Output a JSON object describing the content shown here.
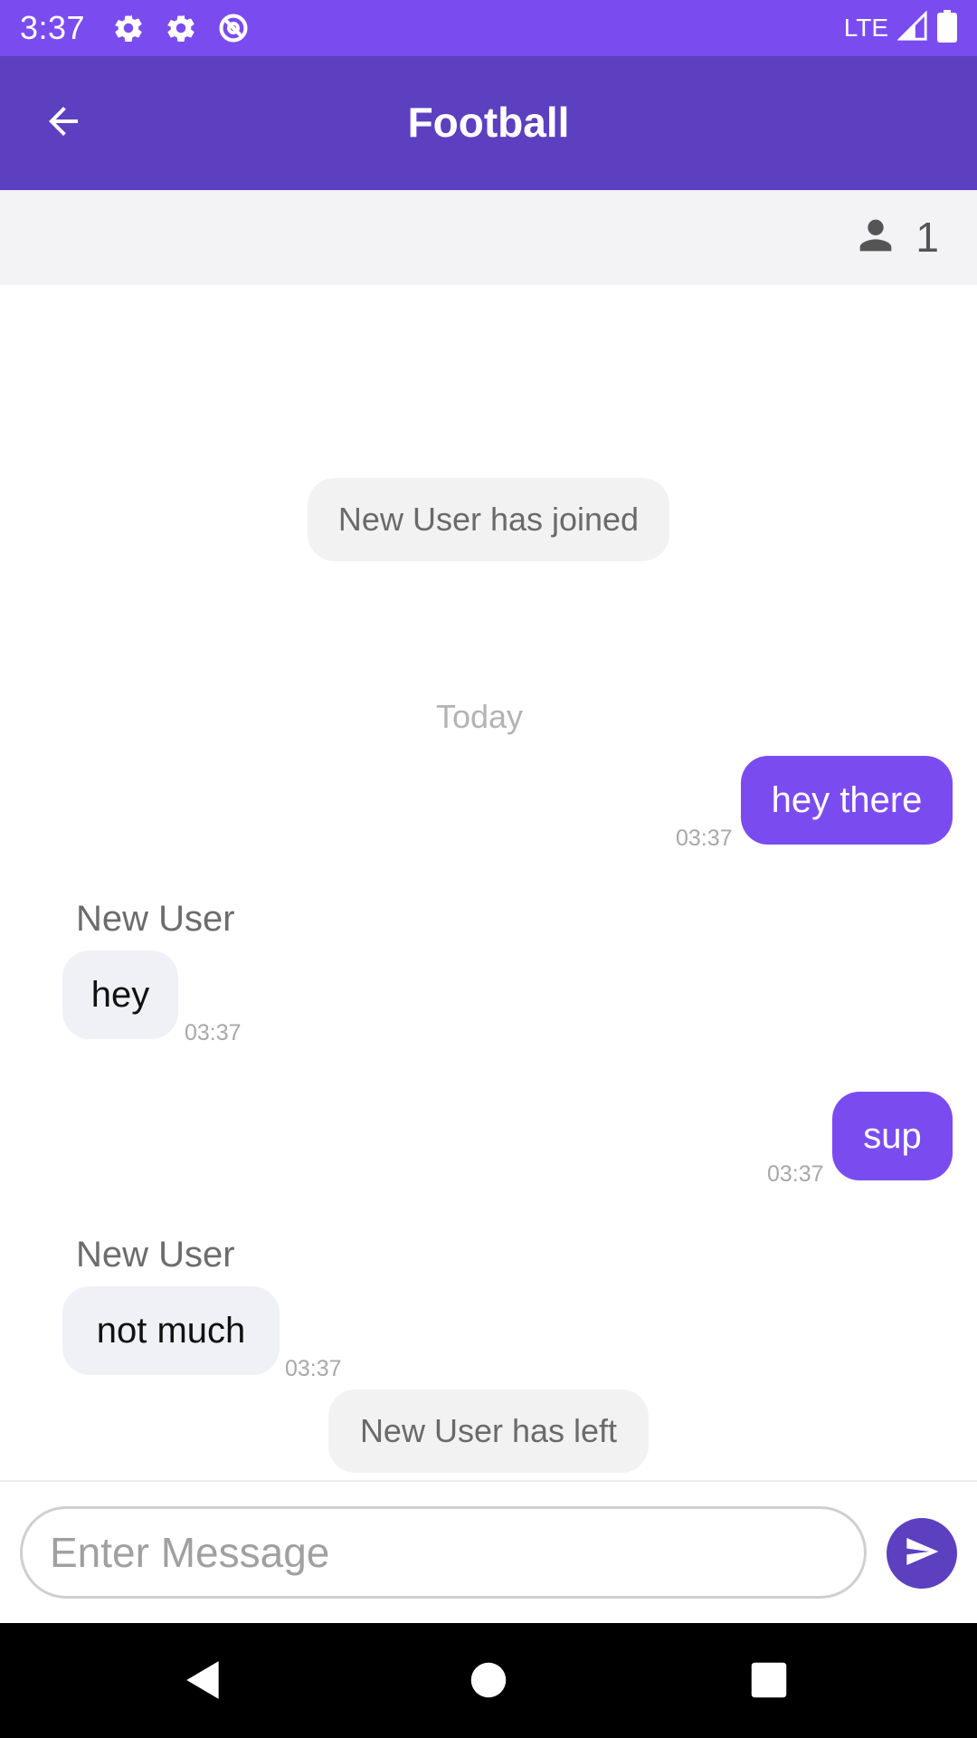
{
  "status_bar": {
    "time": "3:37",
    "network": "LTE",
    "icons": [
      "settings-icon",
      "settings-icon",
      "data-saver-icon",
      "signal-icon",
      "battery-icon"
    ]
  },
  "app_bar": {
    "title": "Football",
    "back_icon": "arrow-left-icon"
  },
  "members": {
    "icon": "person-icon",
    "count": "1"
  },
  "messages": {
    "joined_event": "New User has joined",
    "date_separator": "Today",
    "items": [
      {
        "direction": "out",
        "text": "hey there",
        "time": "03:37"
      },
      {
        "direction": "in",
        "sender": "New User",
        "text": "hey",
        "time": "03:37"
      },
      {
        "direction": "out",
        "text": "sup",
        "time": "03:37"
      },
      {
        "direction": "in",
        "sender": "New User",
        "text": "not much",
        "time": "03:37"
      }
    ],
    "left_event": "New User has left"
  },
  "composer": {
    "placeholder": "Enter Message",
    "value": "",
    "send_icon": "send-icon"
  },
  "nav_bar": {
    "icons": [
      "nav-back-icon",
      "nav-home-icon",
      "nav-recents-icon"
    ]
  },
  "colors": {
    "status_bar": "#7a4cf0",
    "app_bar": "#5d40bf",
    "outgoing_bubble": "#7a4cf0",
    "incoming_bubble": "#eff1f6",
    "send_button": "#5d40bf"
  }
}
